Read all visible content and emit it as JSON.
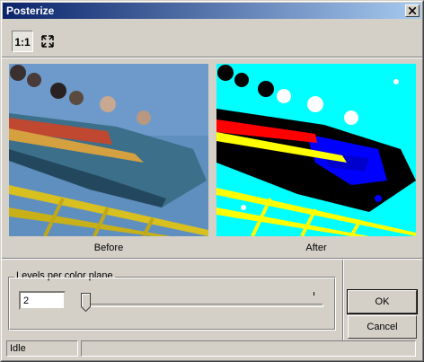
{
  "window": {
    "title": "Posterize"
  },
  "toolbar": {
    "actual_size_label": "1:1",
    "fit_icon": "fit-to-window-icon"
  },
  "previews": {
    "before_caption": "Before",
    "after_caption": "After"
  },
  "levels": {
    "group_label": "Levels per color plane",
    "value": "2",
    "slider_position": 0.0
  },
  "buttons": {
    "ok": "OK",
    "cancel": "Cancel"
  },
  "status": {
    "text": "Idle",
    "secondary": ""
  },
  "colors": {
    "title_start": "#0a246a",
    "title_end": "#a6caf0",
    "face": "#d4d0c8"
  }
}
